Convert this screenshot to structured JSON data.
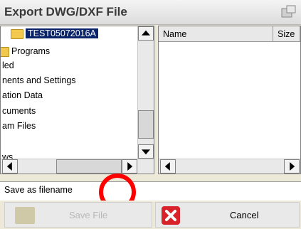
{
  "window": {
    "title": "Export DWG/DXF File",
    "title_icon": "export-drive-icon"
  },
  "tree": {
    "items": [
      {
        "label": "TEST05072016A",
        "selected": true,
        "icon": "folder-icon"
      },
      {
        "label": "Programs",
        "icon": "folder-icon"
      },
      {
        "label": "led"
      },
      {
        "label": "nents and Settings"
      },
      {
        "label": "ation Data"
      },
      {
        "label": "cuments"
      },
      {
        "label": "am Files"
      },
      {
        "label": "ws"
      }
    ]
  },
  "file_list": {
    "columns": [
      "Name",
      "Size"
    ]
  },
  "save": {
    "label": "Save as filename",
    "value": ""
  },
  "buttons": {
    "save_label": "Save File",
    "cancel_label": "Cancel"
  },
  "colors": {
    "selection": "#0a246a",
    "annotation_circle": "#ff0000",
    "cancel_icon": "#d8232a"
  }
}
